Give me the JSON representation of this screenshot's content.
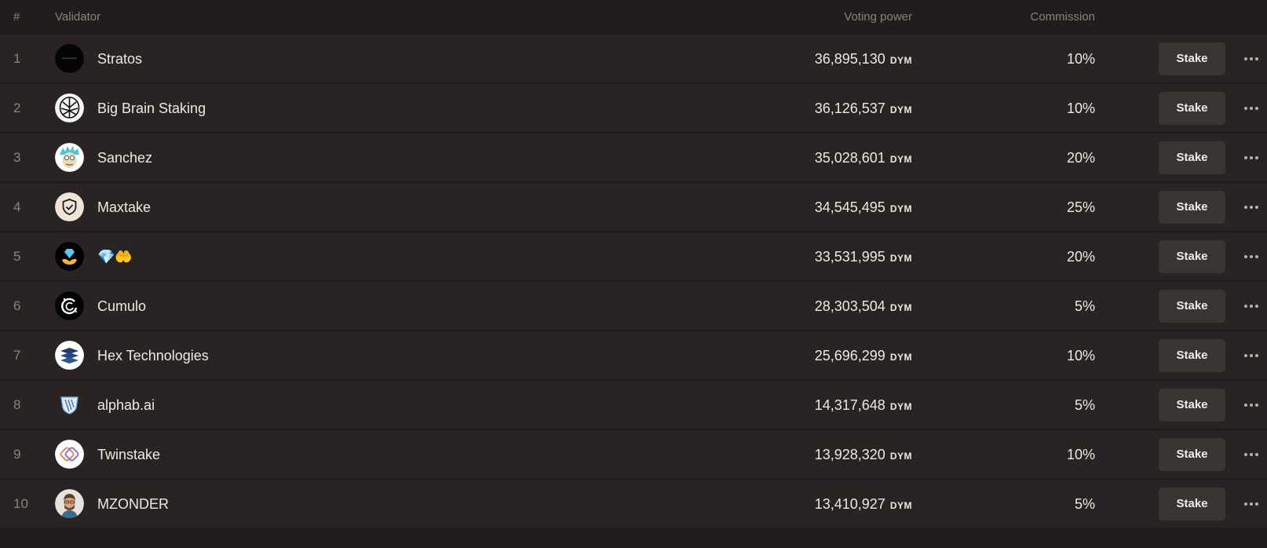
{
  "columns": {
    "rank": "#",
    "validator": "Validator",
    "voting_power": "Voting power",
    "commission": "Commission"
  },
  "rows": [
    {
      "rank": "1",
      "name": "Stratos",
      "power": "36,895,130",
      "unit": "DYM",
      "commission": "10%",
      "action": "Stake",
      "avatar": "stratos-logo"
    },
    {
      "rank": "2",
      "name": "Big Brain Staking",
      "power": "36,126,537",
      "unit": "DYM",
      "commission": "10%",
      "action": "Stake",
      "avatar": "brain-logo"
    },
    {
      "rank": "3",
      "name": "Sanchez",
      "power": "35,028,601",
      "unit": "DYM",
      "commission": "20%",
      "action": "Stake",
      "avatar": "cartoon-face-avatar"
    },
    {
      "rank": "4",
      "name": "Maxtake",
      "power": "34,545,495",
      "unit": "DYM",
      "commission": "25%",
      "action": "Stake",
      "avatar": "shield-check-logo"
    },
    {
      "rank": "5",
      "name": "💎🤲",
      "power": "33,531,995",
      "unit": "DYM",
      "commission": "20%",
      "action": "Stake",
      "avatar": "diamond-hands-logo"
    },
    {
      "rank": "6",
      "name": "Cumulo",
      "power": "28,303,504",
      "unit": "DYM",
      "commission": "5%",
      "action": "Stake",
      "avatar": "swirl-logo"
    },
    {
      "rank": "7",
      "name": "Hex Technologies",
      "power": "25,696,299",
      "unit": "DYM",
      "commission": "10%",
      "action": "Stake",
      "avatar": "layers-logo"
    },
    {
      "rank": "8",
      "name": "alphab.ai",
      "power": "14,317,648",
      "unit": "DYM",
      "commission": "5%",
      "action": "Stake",
      "avatar": "shield-logo"
    },
    {
      "rank": "9",
      "name": "Twinstake",
      "power": "13,928,320",
      "unit": "DYM",
      "commission": "10%",
      "action": "Stake",
      "avatar": "twin-links-logo"
    },
    {
      "rank": "10",
      "name": "MZONDER",
      "power": "13,410,927",
      "unit": "DYM",
      "commission": "5%",
      "action": "Stake",
      "avatar": "person-photo-avatar"
    }
  ]
}
